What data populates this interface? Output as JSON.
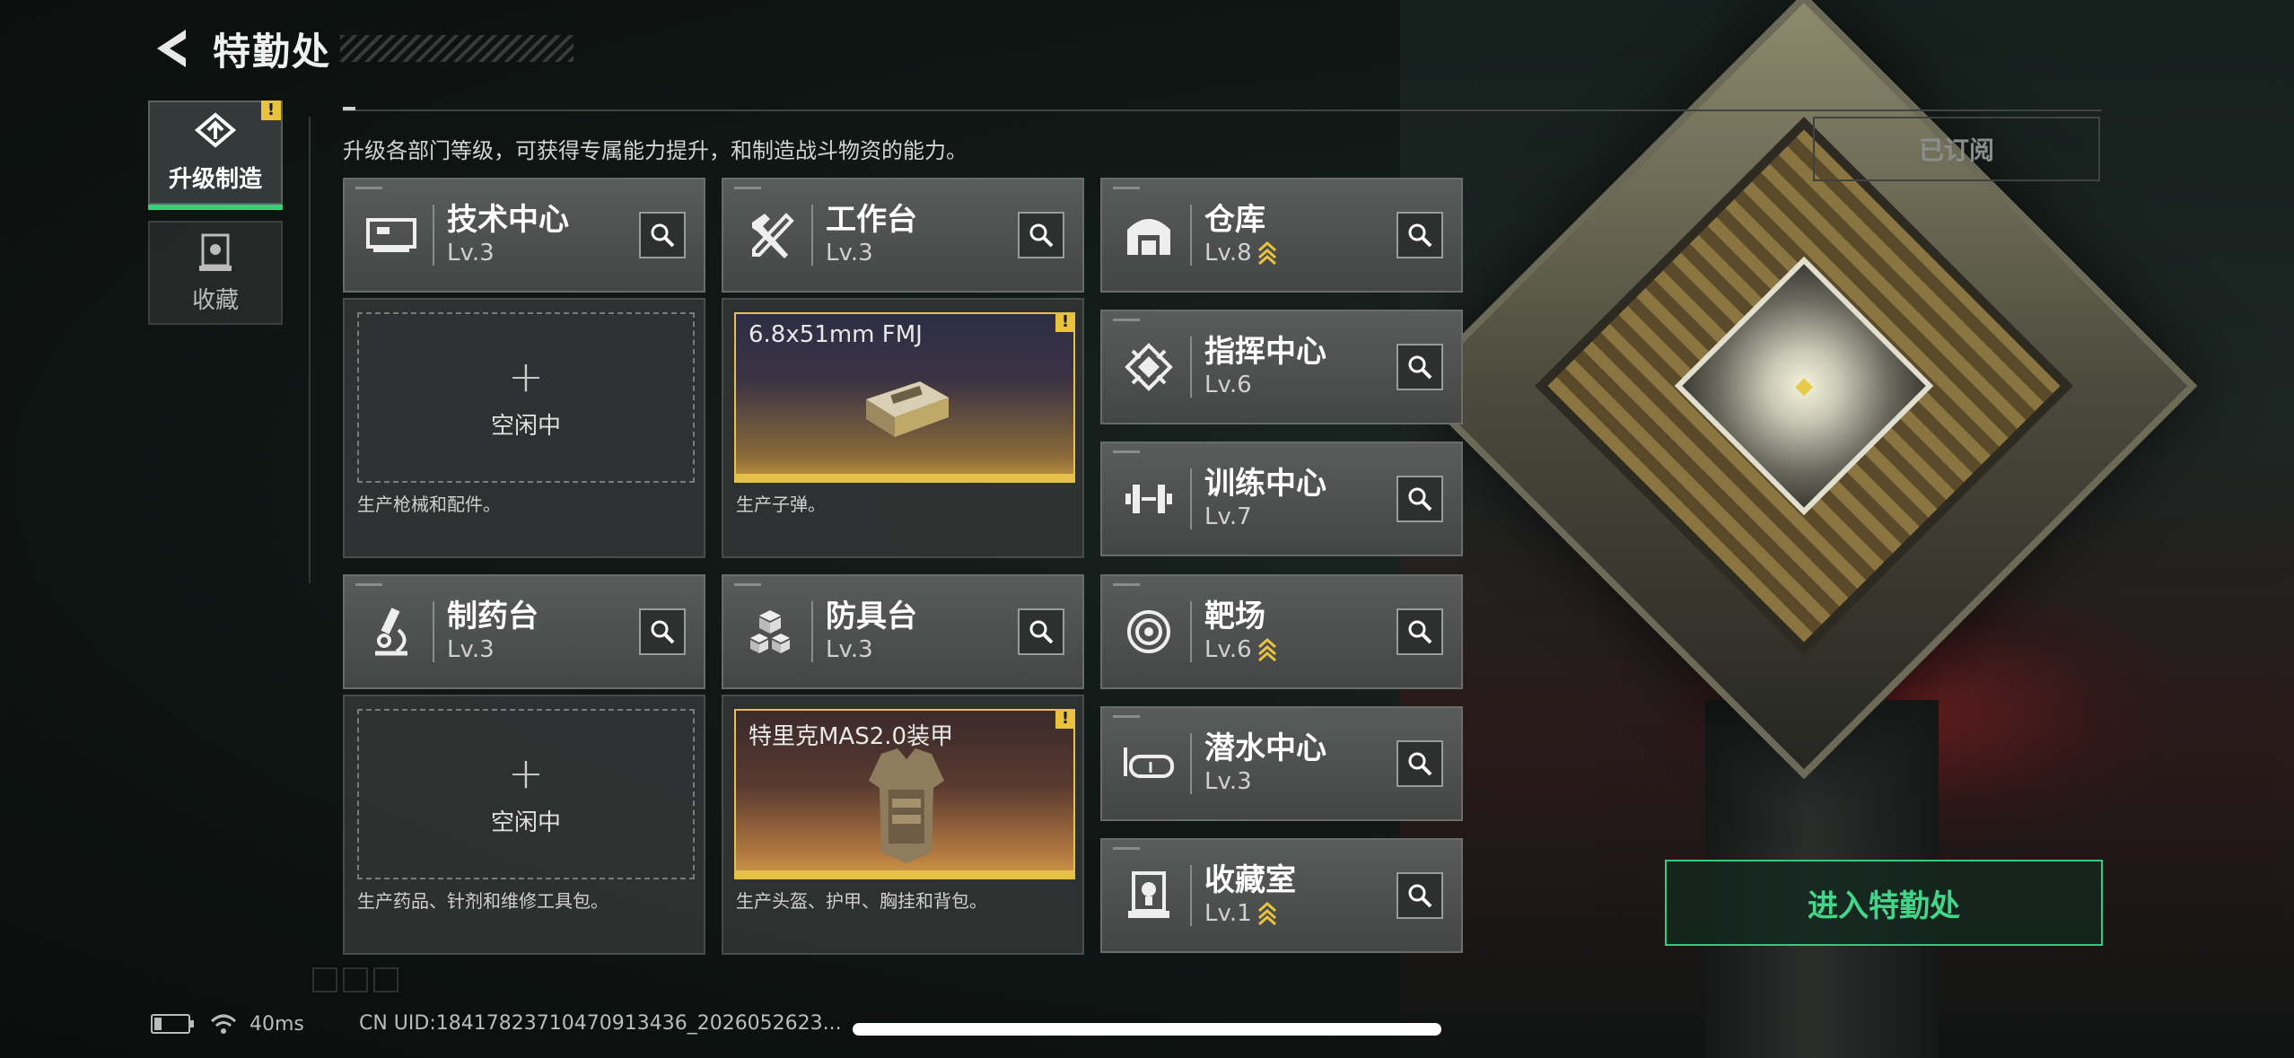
{
  "header": {
    "title": "特勤处"
  },
  "nav": {
    "items": [
      {
        "label": "升级制造",
        "badge": "!"
      },
      {
        "label": "收藏"
      }
    ]
  },
  "subtitle": "升级各部门等级，可获得专属能力提升，和制造战斗物资的能力。",
  "subscribed_label": "已订阅",
  "departments": {
    "tech": {
      "name": "技术中心",
      "level": "Lv.3"
    },
    "workbench": {
      "name": "工作台",
      "level": "Lv.3"
    },
    "pharmacy": {
      "name": "制药台",
      "level": "Lv.3"
    },
    "armory": {
      "name": "防具台",
      "level": "Lv.3"
    },
    "warehouse": {
      "name": "仓库",
      "level": "Lv.8"
    },
    "command": {
      "name": "指挥中心",
      "level": "Lv.6"
    },
    "training": {
      "name": "训练中心",
      "level": "Lv.7"
    },
    "range": {
      "name": "靶场",
      "level": "Lv.6"
    },
    "diving": {
      "name": "潜水中心",
      "level": "Lv.3"
    },
    "collection": {
      "name": "收藏室",
      "level": "Lv.1"
    }
  },
  "panels": {
    "tech": {
      "idle": "空闲中",
      "desc": "生产枪械和配件。"
    },
    "workbench": {
      "product": "6.8x51mm FMJ",
      "badge": "!",
      "desc": "生产子弹。"
    },
    "pharmacy": {
      "idle": "空闲中",
      "desc": "生产药品、针剂和维修工具包。"
    },
    "armory": {
      "product": "特里克MAS2.0装甲",
      "badge": "!",
      "desc": "生产头盔、护甲、胸挂和背包。"
    }
  },
  "enter_button": "进入特勤处",
  "status": {
    "ping": "40ms",
    "uid": "CN UID:18417823710470913436_2026052623..."
  },
  "colors": {
    "accent_green": "#38c97c",
    "warning_yellow": "#e9c23e",
    "card_bg": "#4e5050"
  }
}
